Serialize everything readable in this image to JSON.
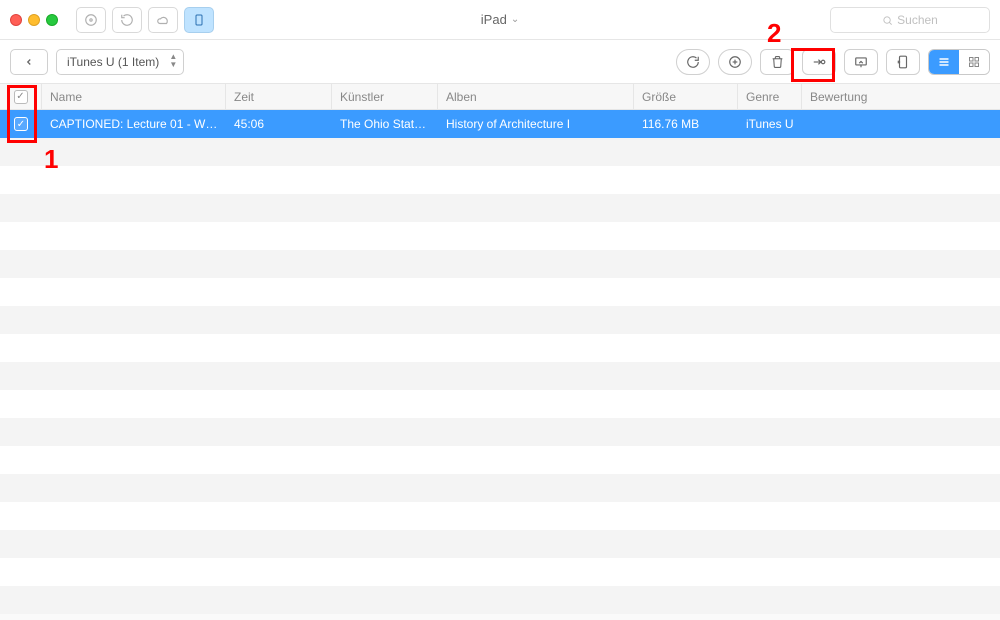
{
  "window": {
    "title": "iPad",
    "search_placeholder": "Suchen"
  },
  "toolbar": {
    "dropdown_label": "iTunes U (1 Item)"
  },
  "columns": {
    "name": "Name",
    "time": "Zeit",
    "artist": "Künstler",
    "album": "Alben",
    "size": "Größe",
    "genre": "Genre",
    "rating": "Bewertung"
  },
  "rows": [
    {
      "name": "CAPTIONED: Lecture 01 - Wh…",
      "time": "45:06",
      "artist": "The Ohio State…",
      "album": "History of Architecture I",
      "size": "116.76 MB",
      "genre": "iTunes U",
      "rating": ""
    }
  ],
  "annotations": {
    "one": "1",
    "two": "2"
  }
}
